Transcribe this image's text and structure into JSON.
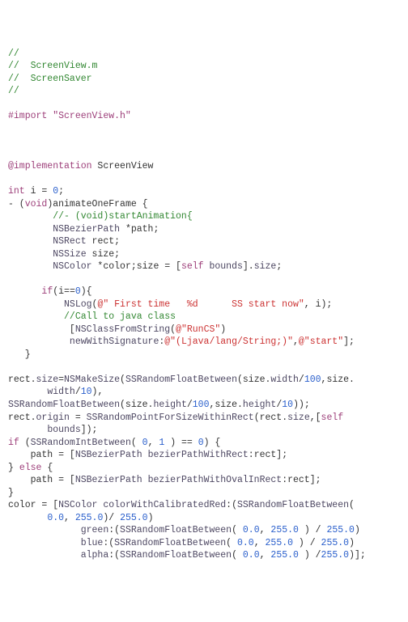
{
  "lines": [
    [
      {
        "t": "//",
        "c": "c-comment"
      }
    ],
    [
      {
        "t": "//  ScreenView.m",
        "c": "c-comment"
      }
    ],
    [
      {
        "t": "//  ScreenSaver",
        "c": "c-comment"
      }
    ],
    [
      {
        "t": "//",
        "c": "c-comment"
      }
    ],
    [],
    [
      {
        "t": "#import \"ScreenView.h\"",
        "c": "c-key"
      }
    ],
    [],
    [],
    [],
    [
      {
        "t": "@implementation",
        "c": "c-key"
      },
      {
        "t": " ScreenView",
        "c": "c-plain"
      }
    ],
    [],
    [
      {
        "t": "int",
        "c": "c-type"
      },
      {
        "t": " i = ",
        "c": "c-plain"
      },
      {
        "t": "0",
        "c": "c-num"
      },
      {
        "t": ";",
        "c": "c-plain"
      }
    ],
    [
      {
        "t": "- (",
        "c": "c-plain"
      },
      {
        "t": "void",
        "c": "c-type"
      },
      {
        "t": ")animateOneFrame {",
        "c": "c-plain"
      }
    ],
    [
      {
        "t": "        //- (void)startAnimation{",
        "c": "c-comment"
      }
    ],
    [
      {
        "t": "        ",
        "c": "c-plain"
      },
      {
        "t": "NSBezierPath",
        "c": "c-call"
      },
      {
        "t": " *path;",
        "c": "c-plain"
      }
    ],
    [
      {
        "t": "        ",
        "c": "c-plain"
      },
      {
        "t": "NSRect",
        "c": "c-call"
      },
      {
        "t": " rect;",
        "c": "c-plain"
      }
    ],
    [
      {
        "t": "        ",
        "c": "c-plain"
      },
      {
        "t": "NSSize",
        "c": "c-call"
      },
      {
        "t": " size;",
        "c": "c-plain"
      }
    ],
    [
      {
        "t": "        ",
        "c": "c-plain"
      },
      {
        "t": "NSColor",
        "c": "c-call"
      },
      {
        "t": " *color;size = [",
        "c": "c-plain"
      },
      {
        "t": "self",
        "c": "c-key"
      },
      {
        "t": " ",
        "c": "c-plain"
      },
      {
        "t": "bounds",
        "c": "c-call"
      },
      {
        "t": "].",
        "c": "c-plain"
      },
      {
        "t": "size",
        "c": "c-call"
      },
      {
        "t": ";",
        "c": "c-plain"
      }
    ],
    [],
    [
      {
        "t": "      ",
        "c": "c-plain"
      },
      {
        "t": "if",
        "c": "c-key"
      },
      {
        "t": "(i==",
        "c": "c-plain"
      },
      {
        "t": "0",
        "c": "c-num"
      },
      {
        "t": "){",
        "c": "c-plain"
      }
    ],
    [
      {
        "t": "          ",
        "c": "c-plain"
      },
      {
        "t": "NSLog",
        "c": "c-call"
      },
      {
        "t": "(",
        "c": "c-plain"
      },
      {
        "t": "@\" First time   %d      SS start now\"",
        "c": "c-string"
      },
      {
        "t": ", i);",
        "c": "c-plain"
      }
    ],
    [
      {
        "t": "          //Call to java class",
        "c": "c-comment"
      }
    ],
    [
      {
        "t": "           [",
        "c": "c-plain"
      },
      {
        "t": "NSClassFromString",
        "c": "c-call"
      },
      {
        "t": "(",
        "c": "c-plain"
      },
      {
        "t": "@\"RunCS\"",
        "c": "c-string"
      },
      {
        "t": ")",
        "c": "c-plain"
      }
    ],
    [
      {
        "t": "           ",
        "c": "c-plain"
      },
      {
        "t": "newWithSignature",
        "c": "c-call"
      },
      {
        "t": ":",
        "c": "c-plain"
      },
      {
        "t": "@\"(Ljava/lang/String;)\"",
        "c": "c-string"
      },
      {
        "t": ",",
        "c": "c-plain"
      },
      {
        "t": "@\"start\"",
        "c": "c-string"
      },
      {
        "t": "];",
        "c": "c-plain"
      }
    ],
    [
      {
        "t": "   }",
        "c": "c-plain"
      }
    ],
    [],
    [
      {
        "t": "rect.",
        "c": "c-plain"
      },
      {
        "t": "size",
        "c": "c-call"
      },
      {
        "t": "=",
        "c": "c-plain"
      },
      {
        "t": "NSMakeSize",
        "c": "c-call"
      },
      {
        "t": "(",
        "c": "c-plain"
      },
      {
        "t": "SSRandomFloatBetween",
        "c": "c-call"
      },
      {
        "t": "(size.",
        "c": "c-plain"
      },
      {
        "t": "width",
        "c": "c-call"
      },
      {
        "t": "/",
        "c": "c-plain"
      },
      {
        "t": "100",
        "c": "c-num"
      },
      {
        "t": ",size.",
        "c": "c-plain"
      }
    ],
    [
      {
        "t": "       ",
        "c": "c-plain"
      },
      {
        "t": "width",
        "c": "c-call"
      },
      {
        "t": "/",
        "c": "c-plain"
      },
      {
        "t": "10",
        "c": "c-num"
      },
      {
        "t": "),",
        "c": "c-plain"
      }
    ],
    [
      {
        "t": "SSRandomFloatBetween",
        "c": "c-call"
      },
      {
        "t": "(size.",
        "c": "c-plain"
      },
      {
        "t": "height",
        "c": "c-call"
      },
      {
        "t": "/",
        "c": "c-plain"
      },
      {
        "t": "100",
        "c": "c-num"
      },
      {
        "t": ",size.",
        "c": "c-plain"
      },
      {
        "t": "height",
        "c": "c-call"
      },
      {
        "t": "/",
        "c": "c-plain"
      },
      {
        "t": "10",
        "c": "c-num"
      },
      {
        "t": "));",
        "c": "c-plain"
      }
    ],
    [
      {
        "t": "rect.",
        "c": "c-plain"
      },
      {
        "t": "origin",
        "c": "c-call"
      },
      {
        "t": " = ",
        "c": "c-plain"
      },
      {
        "t": "SSRandomPointForSizeWithinRect",
        "c": "c-call"
      },
      {
        "t": "(rect.",
        "c": "c-plain"
      },
      {
        "t": "size",
        "c": "c-call"
      },
      {
        "t": ",[",
        "c": "c-plain"
      },
      {
        "t": "self",
        "c": "c-key"
      }
    ],
    [
      {
        "t": "       ",
        "c": "c-plain"
      },
      {
        "t": "bounds",
        "c": "c-call"
      },
      {
        "t": "]);",
        "c": "c-plain"
      }
    ],
    [
      {
        "t": "if",
        "c": "c-key"
      },
      {
        "t": " (",
        "c": "c-plain"
      },
      {
        "t": "SSRandomIntBetween",
        "c": "c-call"
      },
      {
        "t": "( ",
        "c": "c-plain"
      },
      {
        "t": "0",
        "c": "c-num"
      },
      {
        "t": ", ",
        "c": "c-plain"
      },
      {
        "t": "1",
        "c": "c-num"
      },
      {
        "t": " ) == ",
        "c": "c-plain"
      },
      {
        "t": "0",
        "c": "c-num"
      },
      {
        "t": ") {",
        "c": "c-plain"
      }
    ],
    [
      {
        "t": "    path = [",
        "c": "c-plain"
      },
      {
        "t": "NSBezierPath",
        "c": "c-call"
      },
      {
        "t": " ",
        "c": "c-plain"
      },
      {
        "t": "bezierPathWithRect",
        "c": "c-call"
      },
      {
        "t": ":rect];",
        "c": "c-plain"
      }
    ],
    [
      {
        "t": "} ",
        "c": "c-plain"
      },
      {
        "t": "else",
        "c": "c-key"
      },
      {
        "t": " {",
        "c": "c-plain"
      }
    ],
    [
      {
        "t": "    path = [",
        "c": "c-plain"
      },
      {
        "t": "NSBezierPath",
        "c": "c-call"
      },
      {
        "t": " ",
        "c": "c-plain"
      },
      {
        "t": "bezierPathWithOvalInRect",
        "c": "c-call"
      },
      {
        "t": ":rect];",
        "c": "c-plain"
      }
    ],
    [
      {
        "t": "}",
        "c": "c-plain"
      }
    ],
    [
      {
        "t": "color = [",
        "c": "c-plain"
      },
      {
        "t": "NSColor",
        "c": "c-call"
      },
      {
        "t": " ",
        "c": "c-plain"
      },
      {
        "t": "colorWithCalibratedRed",
        "c": "c-call"
      },
      {
        "t": ":(",
        "c": "c-plain"
      },
      {
        "t": "SSRandomFloatBetween",
        "c": "c-call"
      },
      {
        "t": "(",
        "c": "c-plain"
      }
    ],
    [
      {
        "t": "       ",
        "c": "c-plain"
      },
      {
        "t": "0.0",
        "c": "c-num"
      },
      {
        "t": ", ",
        "c": "c-plain"
      },
      {
        "t": "255.0",
        "c": "c-num"
      },
      {
        "t": ")/ ",
        "c": "c-plain"
      },
      {
        "t": "255.0",
        "c": "c-num"
      },
      {
        "t": ")",
        "c": "c-plain"
      }
    ],
    [
      {
        "t": "             ",
        "c": "c-plain"
      },
      {
        "t": "green",
        "c": "c-call"
      },
      {
        "t": ":(",
        "c": "c-plain"
      },
      {
        "t": "SSRandomFloatBetween",
        "c": "c-call"
      },
      {
        "t": "( ",
        "c": "c-plain"
      },
      {
        "t": "0.0",
        "c": "c-num"
      },
      {
        "t": ", ",
        "c": "c-plain"
      },
      {
        "t": "255.0",
        "c": "c-num"
      },
      {
        "t": " ) / ",
        "c": "c-plain"
      },
      {
        "t": "255.0",
        "c": "c-num"
      },
      {
        "t": ")",
        "c": "c-plain"
      }
    ],
    [
      {
        "t": "             ",
        "c": "c-plain"
      },
      {
        "t": "blue",
        "c": "c-call"
      },
      {
        "t": ":(",
        "c": "c-plain"
      },
      {
        "t": "SSRandomFloatBetween",
        "c": "c-call"
      },
      {
        "t": "( ",
        "c": "c-plain"
      },
      {
        "t": "0.0",
        "c": "c-num"
      },
      {
        "t": ", ",
        "c": "c-plain"
      },
      {
        "t": "255.0",
        "c": "c-num"
      },
      {
        "t": " ) / ",
        "c": "c-plain"
      },
      {
        "t": "255.0",
        "c": "c-num"
      },
      {
        "t": ")",
        "c": "c-plain"
      }
    ],
    [
      {
        "t": "             ",
        "c": "c-plain"
      },
      {
        "t": "alpha",
        "c": "c-call"
      },
      {
        "t": ":(",
        "c": "c-plain"
      },
      {
        "t": "SSRandomFloatBetween",
        "c": "c-call"
      },
      {
        "t": "( ",
        "c": "c-plain"
      },
      {
        "t": "0.0",
        "c": "c-num"
      },
      {
        "t": ", ",
        "c": "c-plain"
      },
      {
        "t": "255.0",
        "c": "c-num"
      },
      {
        "t": " ) /",
        "c": "c-plain"
      },
      {
        "t": "255.0",
        "c": "c-num"
      },
      {
        "t": ")];",
        "c": "c-plain"
      }
    ]
  ]
}
